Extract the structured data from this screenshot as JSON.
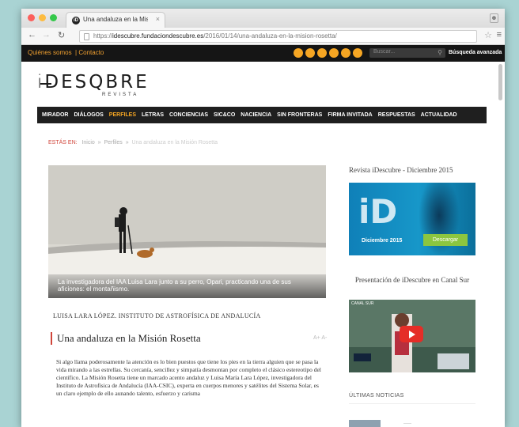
{
  "tab": {
    "title": "Una andaluza en la Misión",
    "close": "×",
    "favicon_label": "iD"
  },
  "address": {
    "url_host": "idescubre.fundaciondescubre.es",
    "url_path": "/2016/01/14/una-andaluza-en-la-mision-rosetta/",
    "url_scheme": "https://"
  },
  "site_top": {
    "quienes": "Quiénes somos",
    "separator": "|",
    "contacto": "Contacto",
    "search_placeholder": "Buscar...",
    "advanced_search": "Búsqueda avanzada",
    "social_icons": [
      "facebook-icon",
      "twitter-icon",
      "flickr-icon",
      "youtube-icon",
      "share-icon",
      "rss-icon"
    ]
  },
  "logo": {
    "text": "DESQBRE",
    "sub": "REVISTA"
  },
  "nav": [
    "MIRADOR",
    "DIÁLOGOS",
    "PERFILES",
    "LETRAS",
    "CONCIENCIAS",
    "SIC&CO",
    "NACIENCIA",
    "SIN FRONTERAS",
    "FIRMA INVITADA",
    "RESPUESTAS",
    "ACTUALIDAD"
  ],
  "nav_active": "PERFILES",
  "breadcrumb": {
    "label": "ESTÁS EN:",
    "items": [
      "Inicio",
      "Perfiles",
      "Una andaluza en la Misión Rosetta"
    ],
    "sep": "»"
  },
  "hero": {
    "caption": "La investigadora del IAA Luisa Lara junto a su perro, Opari, practicando una de sus aficiones: el montañismo."
  },
  "article": {
    "author": "LUISA LARA LÓPEZ. INSTITUTO DE ASTROFÍSICA DE ANDALUCÍA",
    "title": "Una andaluza en la Misión Rosetta",
    "tag": "A+ A-",
    "body": "Si algo llama poderosamente la atención es lo bien puestos que tiene los pies en la tierra alguien que se pasa la vida mirando a las estrellas. Su cercanía, sencillez y simpatía desmontan por completo el clásico estereotipo del científico. La Misión Rosetta tiene un marcado acento andaluz y Luisa María Lara López, investigadora del Instituto de Astrofísica de Andalucía (IAA-CSIC), experta en cuerpos menores y satélites del Sistema Solar, es un claro ejemplo de ello aunando talento, esfuerzo y carisma"
  },
  "sidebar": {
    "revista_heading": "Revista iDescubre - Diciembre 2015",
    "banner_big": "iD",
    "banner_month": "Diciembre 2015",
    "banner_button": "Descargar",
    "canal_heading": "Presentación de iDescubre en Canal Sur",
    "video_label": "CANAL SUR",
    "news_heading": "ÚLTIMAS NOTICIAS"
  },
  "colors": {
    "accent_orange": "#f6a623",
    "red": "#d0453a",
    "nav_bg": "#1f1f1f"
  }
}
